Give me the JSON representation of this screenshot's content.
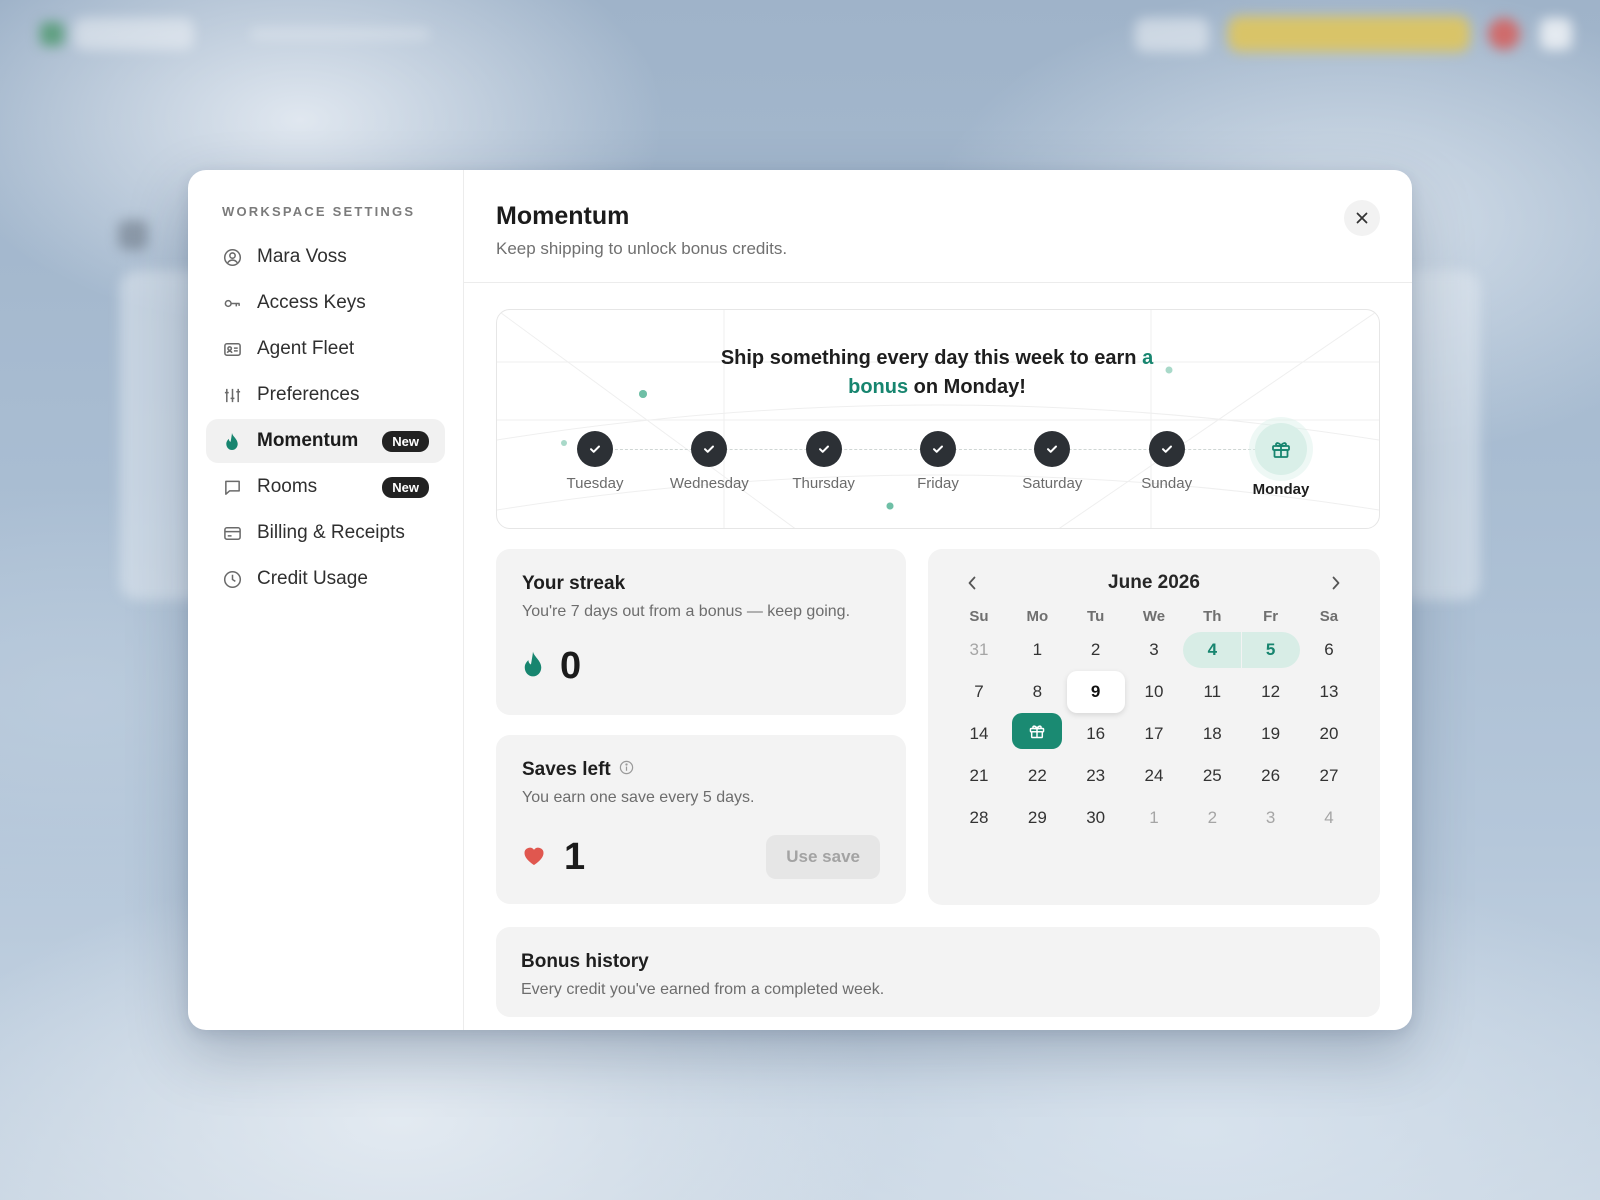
{
  "sidebar": {
    "title": "WORKSPACE SETTINGS",
    "items": [
      {
        "label": "Mara Voss",
        "icon": "user-circle-icon"
      },
      {
        "label": "Access Keys",
        "icon": "key-icon"
      },
      {
        "label": "Agent Fleet",
        "icon": "id-card-icon"
      },
      {
        "label": "Preferences",
        "icon": "sliders-icon"
      },
      {
        "label": "Momentum",
        "icon": "flame-icon",
        "badge": "New",
        "active": true
      },
      {
        "label": "Rooms",
        "icon": "chat-bubble-icon",
        "badge": "New"
      },
      {
        "label": "Billing & Receipts",
        "icon": "credit-card-icon"
      },
      {
        "label": "Credit Usage",
        "icon": "clock-icon"
      }
    ]
  },
  "header": {
    "title": "Momentum",
    "subtitle": "Keep shipping to unlock bonus credits."
  },
  "tracker": {
    "headline_pre": "Ship something every day this week to earn ",
    "headline_accent": "a bonus",
    "headline_post": " on Monday!",
    "days": [
      {
        "label": "Tuesday",
        "done": true
      },
      {
        "label": "Wednesday",
        "done": true
      },
      {
        "label": "Thursday",
        "done": true
      },
      {
        "label": "Friday",
        "done": true
      },
      {
        "label": "Saturday",
        "done": true
      },
      {
        "label": "Sunday",
        "done": true
      },
      {
        "label": "Monday",
        "gift": true
      }
    ]
  },
  "streak": {
    "title": "Your streak",
    "subtitle": "You're 7 days out from a bonus — keep going.",
    "value": "0"
  },
  "saves": {
    "title": "Saves left",
    "subtitle": "You earn one save every 5 days.",
    "value": "1",
    "button": "Use save"
  },
  "calendar": {
    "month": "June 2026",
    "weekdays": [
      "Su",
      "Mo",
      "Tu",
      "We",
      "Th",
      "Fr",
      "Sa"
    ],
    "weeks": [
      [
        "31",
        "1",
        "2",
        "3",
        "4",
        "5",
        "6"
      ],
      [
        "7",
        "8",
        "9",
        "10",
        "11",
        "12",
        "13"
      ],
      [
        "14",
        "",
        "16",
        "17",
        "18",
        "19",
        "20"
      ],
      [
        "21",
        "22",
        "23",
        "24",
        "25",
        "26",
        "27"
      ],
      [
        "28",
        "29",
        "30",
        "1",
        "2",
        "3",
        "4"
      ]
    ],
    "today": "9",
    "highlighted": [
      "4",
      "5"
    ]
  },
  "history": {
    "title": "Bonus history",
    "subtitle": "Every credit you've earned from a completed week."
  },
  "colors": {
    "accent": "#17856f",
    "check_bg": "#2c3035",
    "heart": "#e0574f"
  }
}
